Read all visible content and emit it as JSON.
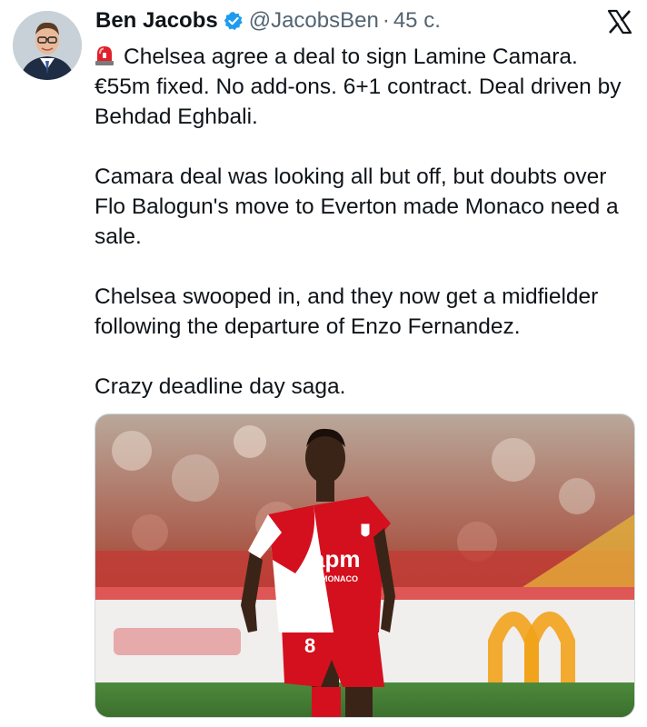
{
  "author": {
    "name": "Ben Jacobs",
    "handle": "@JacobsBen",
    "separator": "·",
    "time": "45 с."
  },
  "icons": {
    "verified": "verified-badge-icon",
    "siren": "siren-emoji-icon",
    "brand": "x-logo-icon"
  },
  "tweet": {
    "paragraphs": [
      "Chelsea agree a deal to sign Lamine Camara. €55m fixed. No add-ons. 6+1 contract. Deal driven by Behdad Eghbali.",
      "Camara deal was looking all but off, but doubts over Flo Balogun's move to Everton made Monaco need a sale.",
      "Chelsea swooped in, and they now get a midfielder following the departure of Enzo Fernandez.",
      "Crazy deadline day saga."
    ]
  },
  "media": {
    "shirt_sponsor": "apm",
    "shirt_sub": "MONACO",
    "shirt_number": "8"
  },
  "colors": {
    "verified_blue": "#1d9bf0",
    "secondary_text": "#536471",
    "monaco_red": "#d4101e"
  }
}
